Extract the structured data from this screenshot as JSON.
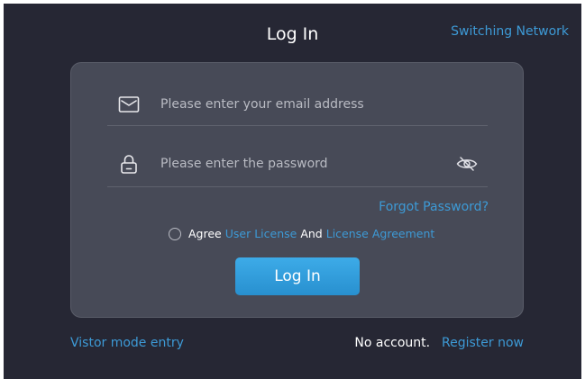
{
  "header": {
    "title": "Log In",
    "switch_network": "Switching Network"
  },
  "form": {
    "email": {
      "value": "",
      "placeholder": "Please enter your email address",
      "icon": "envelope-icon"
    },
    "password": {
      "value": "",
      "placeholder": "Please enter the password",
      "icon": "lock-icon",
      "toggle_icon": "eye-slash-icon"
    },
    "forgot_password": "Forgot Password?",
    "agreement": {
      "checked": false,
      "agree": "Agree",
      "user_license": "User License",
      "and": "And",
      "license_agreement": "License Agreement"
    },
    "submit_label": "Log In"
  },
  "footer": {
    "visitor_entry": "Vistor mode entry",
    "no_account": "No account.",
    "register": "Register now"
  },
  "colors": {
    "background": "#262734",
    "card": "#474a57",
    "accent": "#3d9ad6",
    "button": "#2f9cdc"
  }
}
